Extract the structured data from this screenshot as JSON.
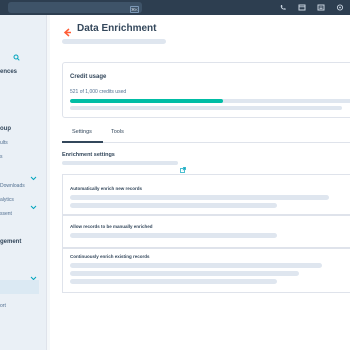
{
  "topbar": {
    "search_shortcut": "⌘K",
    "icons": [
      "phone-icon",
      "calendar-icon",
      "marketplace-icon",
      "help-icon"
    ]
  },
  "sidebar": {
    "items": [
      {
        "label": "ences",
        "style": "bold"
      },
      {
        "label": "oup",
        "style": "bold"
      },
      {
        "label": "ults",
        "style": "light"
      },
      {
        "label": "s",
        "style": "light"
      },
      {
        "label": "Downloads",
        "style": "light"
      },
      {
        "label": "alytics",
        "style": "light"
      },
      {
        "label": "ssent",
        "style": "light"
      },
      {
        "label": "gement",
        "style": "bold"
      },
      {
        "label": "ort",
        "style": "light"
      }
    ]
  },
  "page": {
    "title": "Data Enrichment"
  },
  "credit_usage": {
    "title": "Credit usage",
    "summary": "521 of 1,000 credits used",
    "used": 521,
    "total": 1000,
    "bar_color": "#00bda5"
  },
  "tabs": [
    {
      "label": "Settings",
      "active": true
    },
    {
      "label": "Tools",
      "active": false
    }
  ],
  "enrichment_settings": {
    "title": "Enrichment settings",
    "rows": [
      {
        "label": "Automatically enrich new records"
      },
      {
        "label": "Allow records to be manually enriched"
      },
      {
        "label": "Continuously enrich existing records"
      }
    ]
  },
  "colors": {
    "topbar": "#2d3e50",
    "accent": "#00bda5",
    "back_arrow": "#ff5c35",
    "text": "#33475b"
  }
}
